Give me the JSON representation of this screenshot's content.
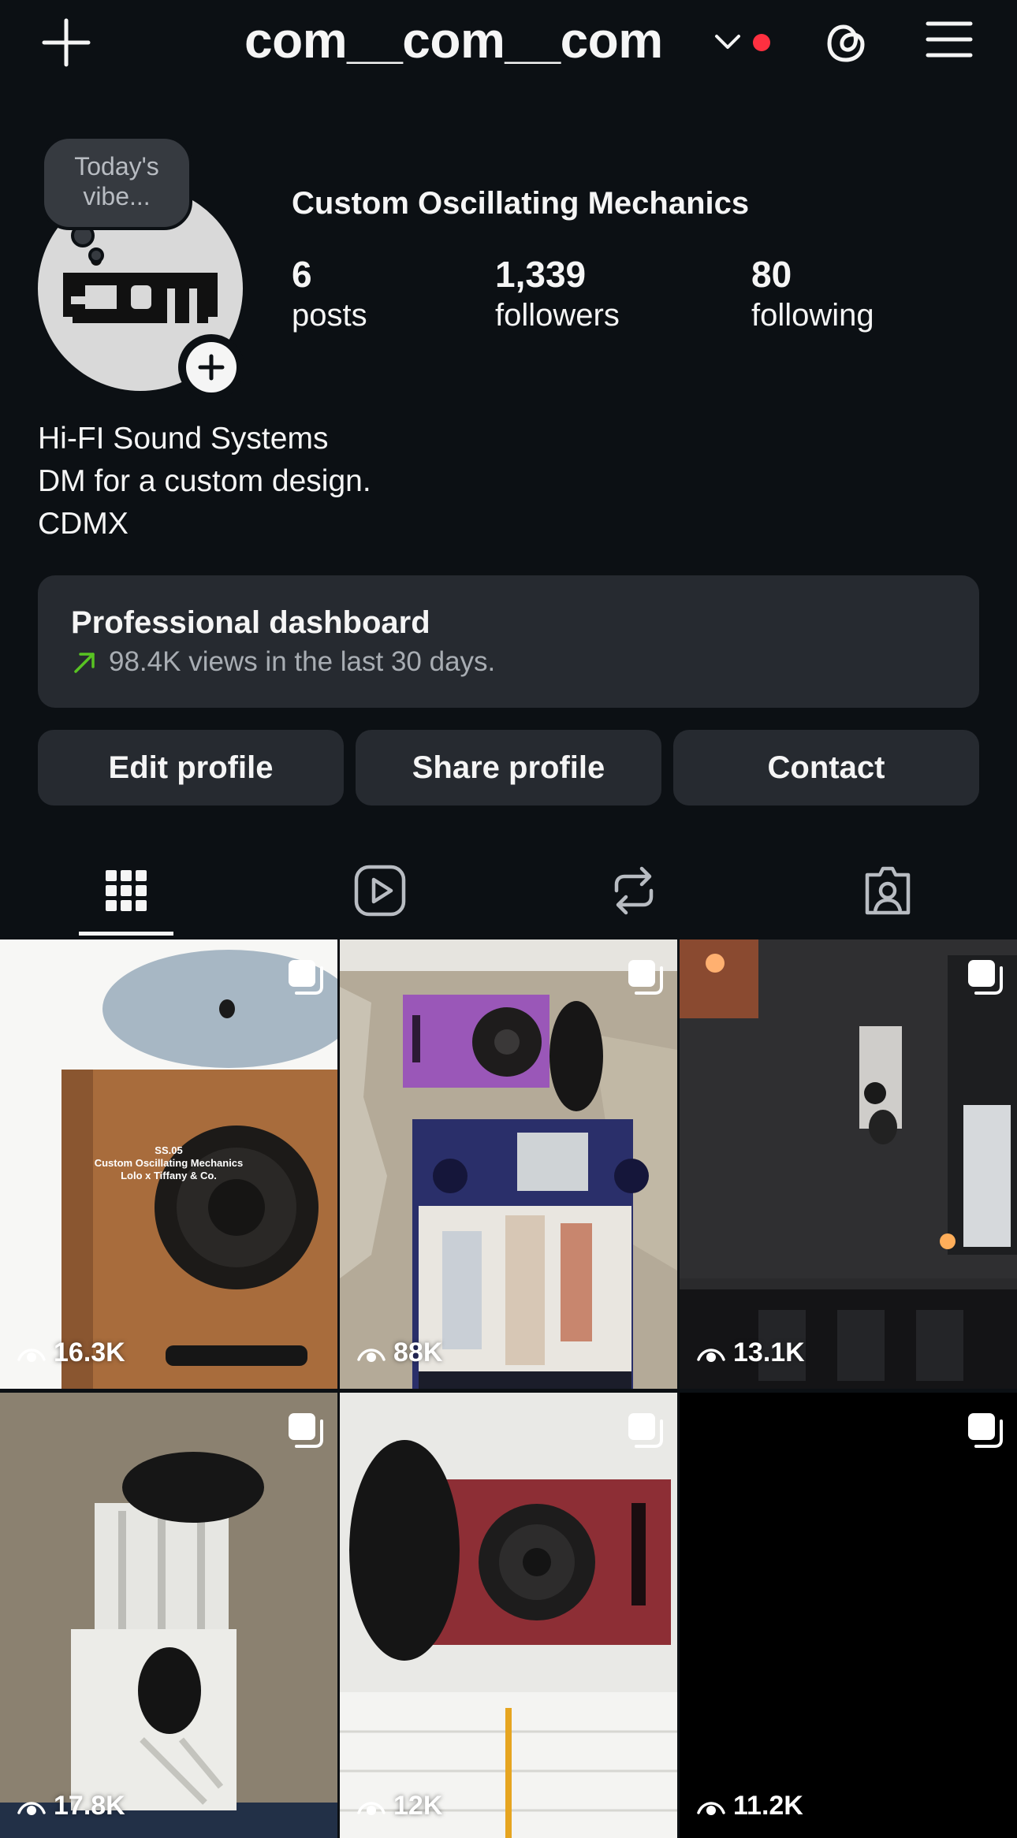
{
  "header": {
    "username": "com__com__com"
  },
  "profile": {
    "note": "Today's vibe...",
    "full_name": "Custom Oscillating Mechanics",
    "stats": [
      {
        "value": "6",
        "label": "posts"
      },
      {
        "value": "1,339",
        "label": "followers"
      },
      {
        "value": "80",
        "label": "following"
      }
    ],
    "bio": [
      "Hi-FI Sound Systems",
      "DM for a custom design.",
      "CDMX"
    ]
  },
  "dashboard": {
    "title": "Professional dashboard",
    "subtitle": "98.4K views in the last 30 days."
  },
  "buttons": {
    "edit": "Edit profile",
    "share": "Share profile",
    "contact": "Contact"
  },
  "posts": [
    {
      "views": "16.3K",
      "caption": [
        "SS.05",
        "Custom Oscillating Mechanics",
        "Lolo x Tiffany & Co."
      ]
    },
    {
      "views": "88K"
    },
    {
      "views": "13.1K"
    },
    {
      "views": "17.8K"
    },
    {
      "views": "12K"
    },
    {
      "views": "11.2K"
    }
  ],
  "colors": {
    "background": "#0c1014",
    "card": "#262a30",
    "accent_red": "#ff3040",
    "trend_green": "#58c322"
  }
}
